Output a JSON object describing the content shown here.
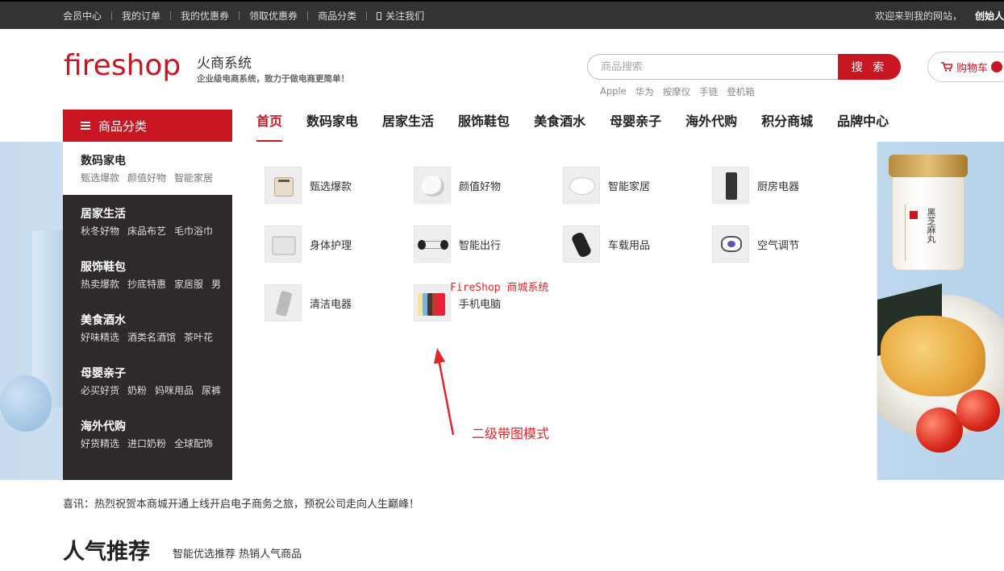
{
  "topbar": {
    "links": [
      "会员中心",
      "我的订单",
      "我的优惠券",
      "领取优惠券",
      "商品分类",
      "关注我们"
    ],
    "welcome": "欢迎来到我的网站，",
    "user": "创始人"
  },
  "header": {
    "logo": "fireshop",
    "brand_name": "火商系统",
    "slogan": "企业级电商系统，致力于做电商更简单！",
    "search_placeholder": "商品搜索",
    "search_button": "搜 索",
    "hot_words": [
      "Apple",
      "华为",
      "按摩仪",
      "手链",
      "登机箱"
    ],
    "cart_label": "购物车"
  },
  "nav": {
    "category_label": "商品分类",
    "items": [
      "首页",
      "数码家电",
      "居家生活",
      "服饰鞋包",
      "美食酒水",
      "母婴亲子",
      "海外代购",
      "积分商城",
      "品牌中心"
    ],
    "active_index": 0
  },
  "categories": [
    {
      "title": "数码家电",
      "subs": [
        "甄选爆款",
        "颜值好物",
        "智能家居"
      ],
      "active": true
    },
    {
      "title": "居家生活",
      "subs": [
        "秋冬好物",
        "床品布艺",
        "毛巾浴巾"
      ]
    },
    {
      "title": "服饰鞋包",
      "subs": [
        "热卖爆款",
        "抄底特惠",
        "家居服",
        "男"
      ]
    },
    {
      "title": "美食酒水",
      "subs": [
        "好味精选",
        "酒类名酒馆",
        "茶叶花"
      ]
    },
    {
      "title": "母婴亲子",
      "subs": [
        "必买好货",
        "奶粉",
        "妈咪用品",
        "尿裤"
      ]
    },
    {
      "title": "海外代购",
      "subs": [
        "好货精选",
        "进口奶粉",
        "全球配饰"
      ]
    }
  ],
  "flyout_items": [
    {
      "label": "甄选爆款",
      "icon": "toaster-icon"
    },
    {
      "label": "颜值好物",
      "icon": "cup-icon"
    },
    {
      "label": "智能家居",
      "icon": "robot-vacuum-icon"
    },
    {
      "label": "厨房电器",
      "icon": "blender-icon"
    },
    {
      "label": "身体护理",
      "icon": "massage-belt-icon"
    },
    {
      "label": "智能出行",
      "icon": "hoverboard-icon"
    },
    {
      "label": "车载用品",
      "icon": "car-holder-icon"
    },
    {
      "label": "空气调节",
      "icon": "mite-remover-icon"
    },
    {
      "label": "清洁电器",
      "icon": "vacuum-icon"
    },
    {
      "label": "手机电脑",
      "icon": "phones-icon"
    }
  ],
  "annotations": {
    "watermark": "FireShop 商城系统",
    "note": "二级带图模式"
  },
  "banner_jar_text": "黑芝麻丸",
  "notice": "喜讯：热烈祝贺本商城开通上线开启电子商务之旅，预祝公司走向人生巅峰！",
  "section": {
    "title": "人气推荐",
    "subtitle": "智能优选推荐 热销人气商品"
  },
  "colors": {
    "brand": "#c81623",
    "topbar": "#333333",
    "sidebar": "#2e2a2a",
    "annotation": "#e0262a"
  },
  "phone_colors": [
    "#f2e6a0",
    "#7fb3d6",
    "#3c3c3c",
    "#c0392b",
    "#e8223a"
  ]
}
